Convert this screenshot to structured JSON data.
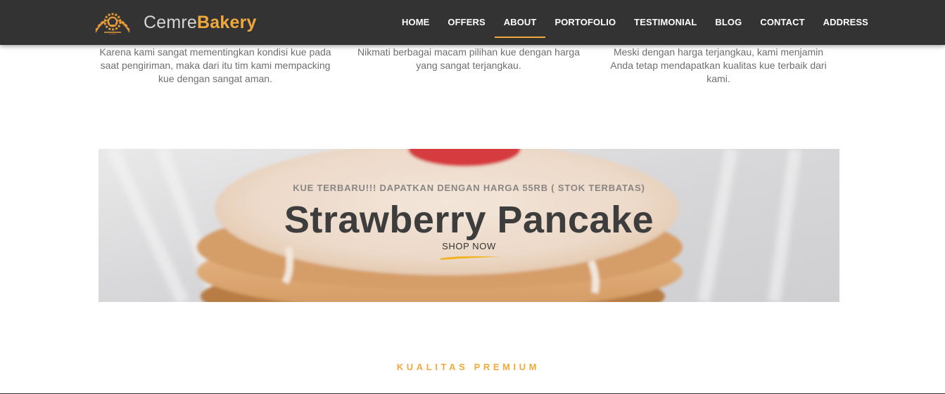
{
  "header": {
    "brand_light": "Cemre",
    "brand_bold": "Bakery",
    "logo_icon": "bakery-chef-hat-wheat-logo",
    "accent_color": "#f2a93b",
    "background_color": "#333333"
  },
  "nav": {
    "items": [
      {
        "label": "HOME",
        "active": false
      },
      {
        "label": "OFFERS",
        "active": false
      },
      {
        "label": "ABOUT",
        "active": true
      },
      {
        "label": "PORTOFOLIO",
        "active": false
      },
      {
        "label": "TESTIMONIAL",
        "active": false
      },
      {
        "label": "BLOG",
        "active": false
      },
      {
        "label": "CONTACT",
        "active": false
      },
      {
        "label": "ADDRESS",
        "active": false
      }
    ]
  },
  "features": [
    {
      "text": "Karena kami sangat mementingkan kondisi kue pada saat pengiriman, maka dari itu tim kami mempacking kue dengan sangat aman."
    },
    {
      "text": "Nikmati berbagai macam pilihan kue dengan harga yang sangat terjangkau."
    },
    {
      "text": "Meski dengan harga terjangkau, kami menjamin Anda tetap mendapatkan kualitas kue terbaik dari kami."
    }
  ],
  "banner": {
    "subtitle": "KUE TERBARU!!! DAPATKAN DENGAN HARGA 55RB ( STOK TERBATAS)",
    "title": "Strawberry Pancake",
    "cta_label": "SHOP NOW"
  },
  "section": {
    "title": "KUALITAS PREMIUM"
  }
}
